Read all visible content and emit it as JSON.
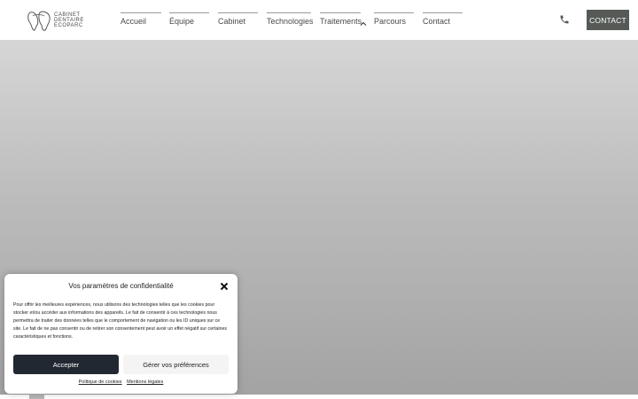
{
  "header": {
    "logo": {
      "line1": "CABINET",
      "line2": "DENTAIRE",
      "line3": "ECOPARC"
    },
    "nav": [
      {
        "label": "Accueil"
      },
      {
        "label": "Équipe"
      },
      {
        "label": "Cabinet"
      },
      {
        "label": "Technologies"
      },
      {
        "label": "Traitements"
      },
      {
        "label": "Parcours"
      },
      {
        "label": "Contact"
      }
    ],
    "contact_label": "CONTACT"
  },
  "cookie_banner": {
    "title": "Vos paramètres de confidentialité",
    "body": "Pour offrir les meilleures expériences, nous utilisons des technologies telles que les cookies pour stocker et/ou accéder aux informations des appareils. Le fait de consentir à ces technologies nous permettra de traiter des données telles que le comportement de navigation ou les ID uniques sur ce site. Le fait de ne pas consentir ou de retirer son consentement peut avoir un effet négatif sur certaines caractéristiques et fonctions.",
    "accept_label": "Accepter",
    "prefs_label": "Gérer vos préférences",
    "links": {
      "cookies": "Politique de cookies",
      "legal": "Mentions légales"
    }
  },
  "colors": {
    "contact_button": "#555a57",
    "accept_button": "#222831",
    "prefs_button": "#f4f4f4"
  },
  "icons": [
    "tooth-logo-icon",
    "chevron-down-icon",
    "phone-icon",
    "close-icon"
  ]
}
